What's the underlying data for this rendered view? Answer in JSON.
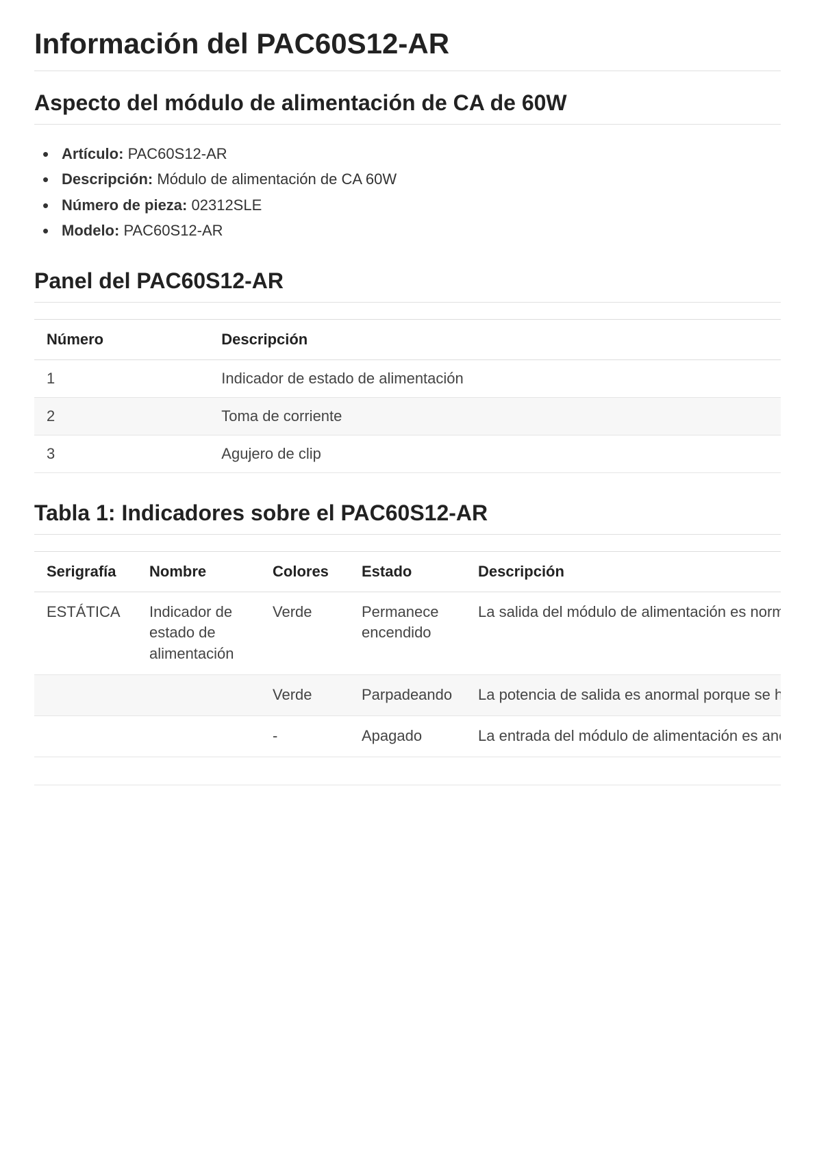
{
  "page_title": "Información del PAC60S12-AR",
  "section1": {
    "heading": "Aspecto del módulo de alimentación de CA de 60W",
    "items": [
      {
        "label": "Artículo:",
        "value": "PAC60S12-AR"
      },
      {
        "label": "Descripción:",
        "value": "Módulo de alimentación de CA 60W"
      },
      {
        "label": "Número de pieza:",
        "value": "02312SLE"
      },
      {
        "label": "Modelo:",
        "value": "PAC60S12-AR"
      }
    ]
  },
  "section2": {
    "heading": "Panel del PAC60S12-AR",
    "headers": [
      "Número",
      "Descripción"
    ],
    "rows": [
      [
        "1",
        "Indicador de estado de alimentación"
      ],
      [
        "2",
        "Toma de corriente"
      ],
      [
        "3",
        "Agujero de clip"
      ]
    ]
  },
  "section3": {
    "heading": "Tabla 1: Indicadores sobre el PAC60S12-AR",
    "headers": [
      "Serigrafía",
      "Nombre",
      "Colores",
      "Estado",
      "Descripción"
    ],
    "rows": [
      [
        "ESTÁTICA",
        "Indicador de estado de alimentación",
        "Verde",
        "Permanece encendido",
        "La salida del módulo de alimentación es normal."
      ],
      [
        "",
        "",
        "Verde",
        "Parpadeando",
        "La potencia de salida es anormal porque se ha producido sobretemperatura, sobretensión o sobrecorriente."
      ],
      [
        "",
        "",
        "-",
        "Apagado",
        "La entrada del módulo de alimentación es anormal. Por ejemplo, no hay entrada de CA, se ha producido sobretensión de entrada de CA o subtensión."
      ]
    ]
  }
}
